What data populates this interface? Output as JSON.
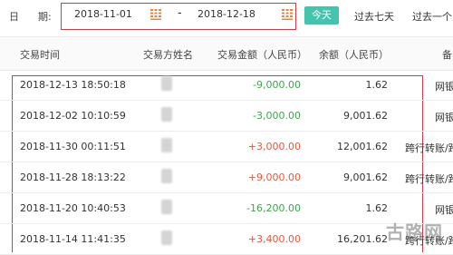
{
  "filter": {
    "date_label_1": "日",
    "date_label_2": "期:",
    "start_date": "2018-11-01",
    "separator": "-",
    "end_date": "2018-12-18",
    "today_button": "今天",
    "quick_1": "过去七天",
    "quick_2": "过去一个"
  },
  "table": {
    "headers": [
      "交易时间",
      "交易方姓名",
      "交易金额（人民币）",
      "余额（人民币）",
      "备"
    ],
    "rows": [
      {
        "time": "2018-12-13 18:50:18",
        "amount": "-9,000.00",
        "balance": "1.62",
        "type": "网银"
      },
      {
        "time": "2018-12-02 10:10:59",
        "amount": "-3,000.00",
        "balance": "9,001.62",
        "type": "网银"
      },
      {
        "time": "2018-11-30 00:11:51",
        "amount": "+3,000.00",
        "balance": "12,001.62",
        "type": "跨行转账/跨"
      },
      {
        "time": "2018-11-28 18:13:22",
        "amount": "+9,000.00",
        "balance": "9,001.62",
        "type": "跨行转账/跨"
      },
      {
        "time": "2018-11-20 10:40:53",
        "amount": "-16,200.00",
        "balance": "1.62",
        "type": "网银"
      },
      {
        "time": "2018-11-14 11:41:35",
        "amount": "+3,400.00",
        "balance": "16,201.62",
        "type": "跨行转账/跨"
      }
    ]
  },
  "watermark": "古路网",
  "colors": {
    "accent": "#45c4ad",
    "positive": "#e8563f",
    "negative": "#3ea64b",
    "highlight_border": "#cf3b47",
    "calendar_icon": "#e8843f"
  }
}
